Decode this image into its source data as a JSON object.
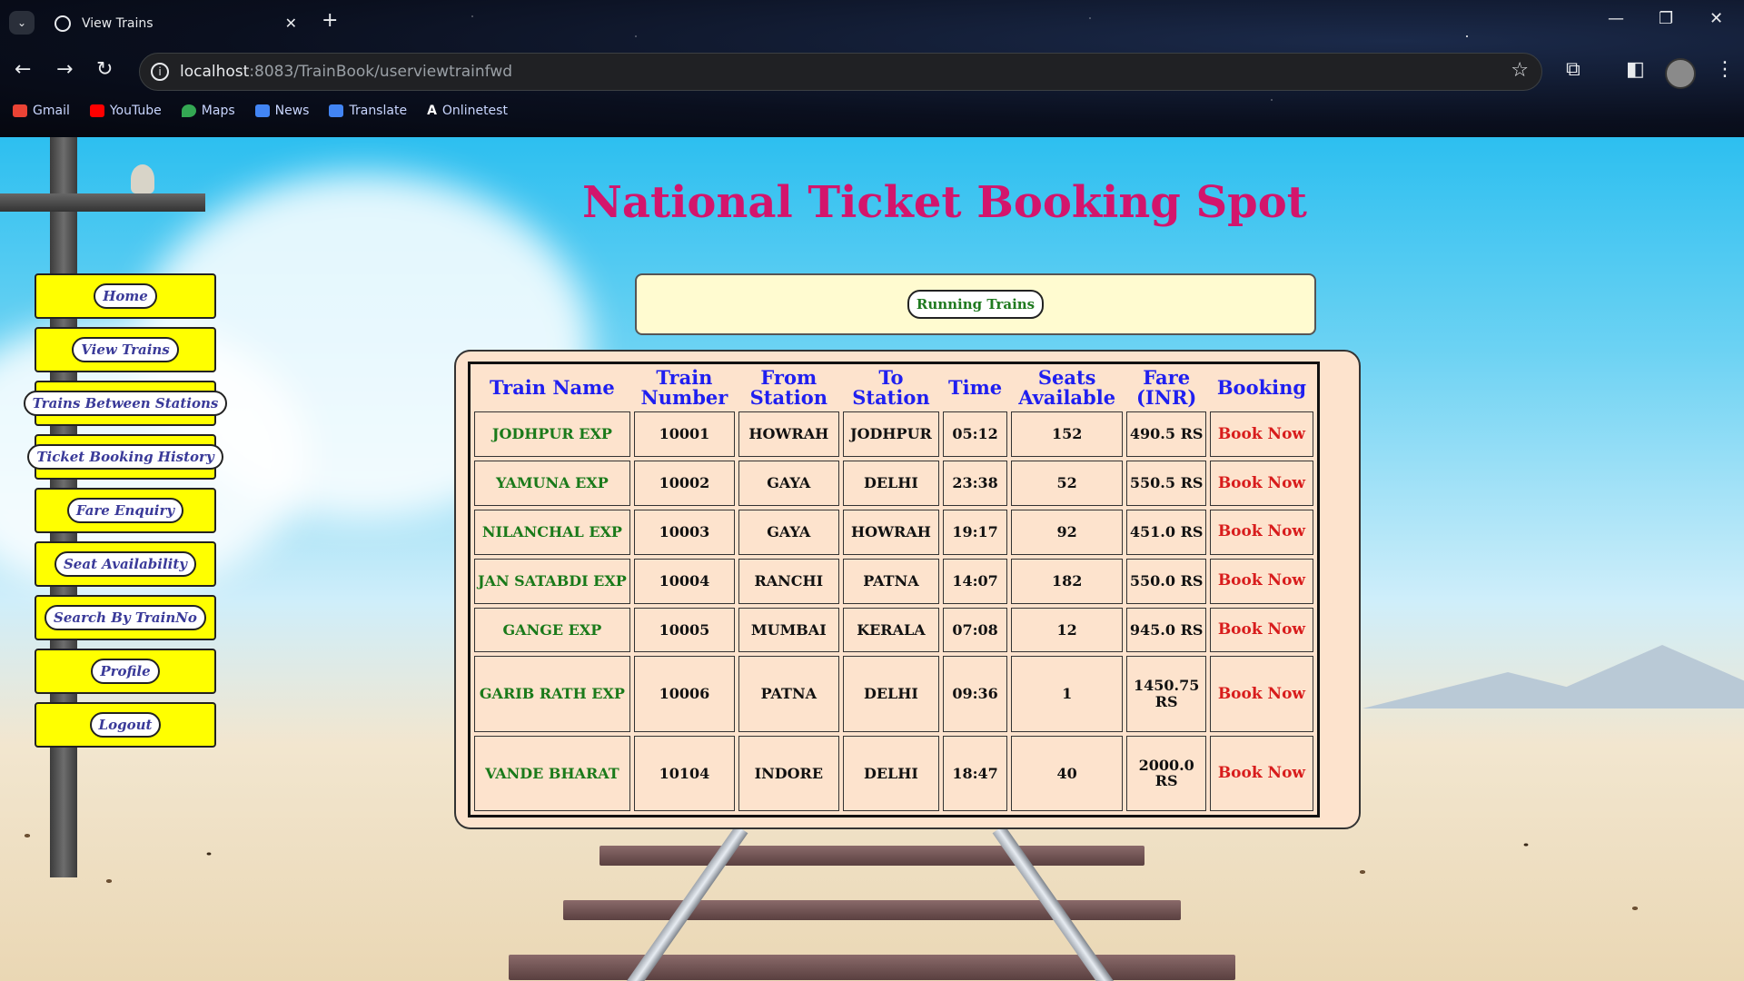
{
  "browser": {
    "tab_title": "View Trains",
    "url_host": "localhost",
    "url_rest": ":8083/TrainBook/userviewtrainfwd",
    "bookmarks": [
      {
        "label": "Gmail",
        "color": "#ea4335"
      },
      {
        "label": "YouTube",
        "color": "#ff0000"
      },
      {
        "label": "Maps",
        "color": "#34a853"
      },
      {
        "label": "News",
        "color": "#4285f4"
      },
      {
        "label": "Translate",
        "color": "#4285f4"
      },
      {
        "label": "Onlinetest",
        "color": "#ffffff"
      }
    ]
  },
  "page": {
    "title": "National Ticket Booking Spot",
    "running_trains_label": "Running Trains"
  },
  "sidebar": {
    "items": [
      {
        "label": "Home"
      },
      {
        "label": "View Trains"
      },
      {
        "label": "Trains Between Stations"
      },
      {
        "label": "Ticket Booking History"
      },
      {
        "label": "Fare Enquiry"
      },
      {
        "label": "Seat Availability"
      },
      {
        "label": "Search By TrainNo"
      },
      {
        "label": "Profile"
      },
      {
        "label": "Logout"
      }
    ]
  },
  "table": {
    "headers": [
      "Train Name",
      "Train Number",
      "From Station",
      "To Station",
      "Time",
      "Seats Available",
      "Fare (INR)",
      "Booking"
    ],
    "rows": [
      {
        "name": "JODHPUR EXP",
        "number": "10001",
        "from": "HOWRAH",
        "to": "JODHPUR",
        "time": "05:12",
        "seats": "152",
        "fare": "490.5 RS",
        "booking": "Book Now"
      },
      {
        "name": "YAMUNA EXP",
        "number": "10002",
        "from": "GAYA",
        "to": "DELHI",
        "time": "23:38",
        "seats": "52",
        "fare": "550.5 RS",
        "booking": "Book Now"
      },
      {
        "name": "NILANCHAL EXP",
        "number": "10003",
        "from": "GAYA",
        "to": "HOWRAH",
        "time": "19:17",
        "seats": "92",
        "fare": "451.0 RS",
        "booking": "Book Now"
      },
      {
        "name": "JAN SATABDI EXP",
        "number": "10004",
        "from": "RANCHI",
        "to": "PATNA",
        "time": "14:07",
        "seats": "182",
        "fare": "550.0 RS",
        "booking": "Book Now"
      },
      {
        "name": "GANGE EXP",
        "number": "10005",
        "from": "MUMBAI",
        "to": "KERALA",
        "time": "07:08",
        "seats": "12",
        "fare": "945.0 RS",
        "booking": "Book Now"
      },
      {
        "name": "GARIB RATH EXP",
        "number": "10006",
        "from": "PATNA",
        "to": "DELHI",
        "time": "09:36",
        "seats": "1",
        "fare": "1450.75 RS",
        "booking": "Book Now"
      },
      {
        "name": "VANDE BHARAT",
        "number": "10104",
        "from": "INDORE",
        "to": "DELHI",
        "time": "18:47",
        "seats": "40",
        "fare": "2000.0 RS",
        "booking": "Book Now"
      }
    ]
  },
  "colors": {
    "title": "#d3156c",
    "sidebar_bg": "#ffff00",
    "header_text": "#1f1ff0",
    "train_name": "#1a7a1a",
    "book_now": "#d81c1c"
  }
}
